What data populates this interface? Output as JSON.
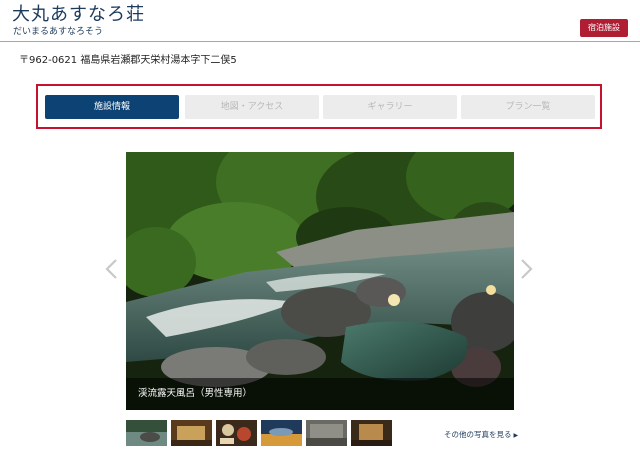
{
  "header": {
    "title": "大丸あすなろ荘",
    "subtitle": "だいまるあすなろそう",
    "badge": "宿泊施設",
    "accent_color": "#b01e34",
    "brand_color": "#1b3a5c"
  },
  "address": "〒962-0621 福島県岩瀬郡天栄村湯本字下二俣5",
  "tabs": [
    {
      "label": "施設情報",
      "active": true
    },
    {
      "label": "地図・アクセス",
      "active": false
    },
    {
      "label": "ギャラリー",
      "active": false
    },
    {
      "label": "プラン一覧",
      "active": false
    }
  ],
  "gallery": {
    "caption": "渓流露天風呂（男性専用）",
    "prev_icon": "chevron-left-icon",
    "next_icon": "chevron-right-icon",
    "more_link": "その他の写真を見る",
    "more_icon": "triangle-right-icon",
    "thumbnail_count": 6
  }
}
